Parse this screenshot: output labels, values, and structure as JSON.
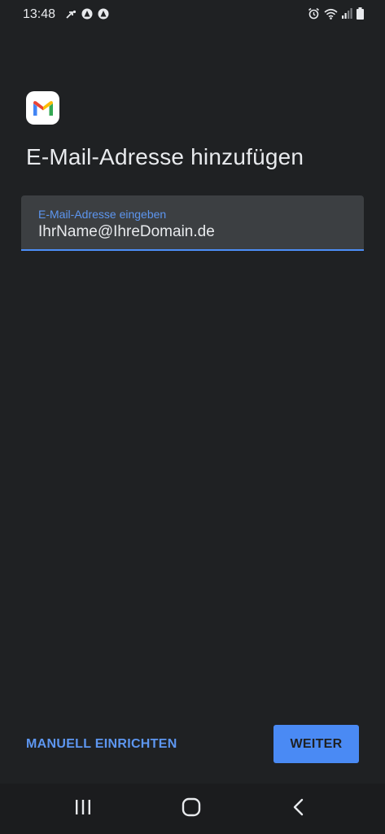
{
  "status_bar": {
    "time": "13:48"
  },
  "app": {
    "logo_icon": "gmail-logo-icon",
    "title": "E-Mail-Adresse hinzufügen"
  },
  "email_field": {
    "label": "E-Mail-Adresse eingeben",
    "value": "IhrName@IhreDomain.de"
  },
  "actions": {
    "manual_label": "MANUELL EINRICHTEN",
    "next_label": "WEITER"
  },
  "colors": {
    "background": "#1f2123",
    "accent": "#4a8af4",
    "field_background": "#3c3f42"
  }
}
